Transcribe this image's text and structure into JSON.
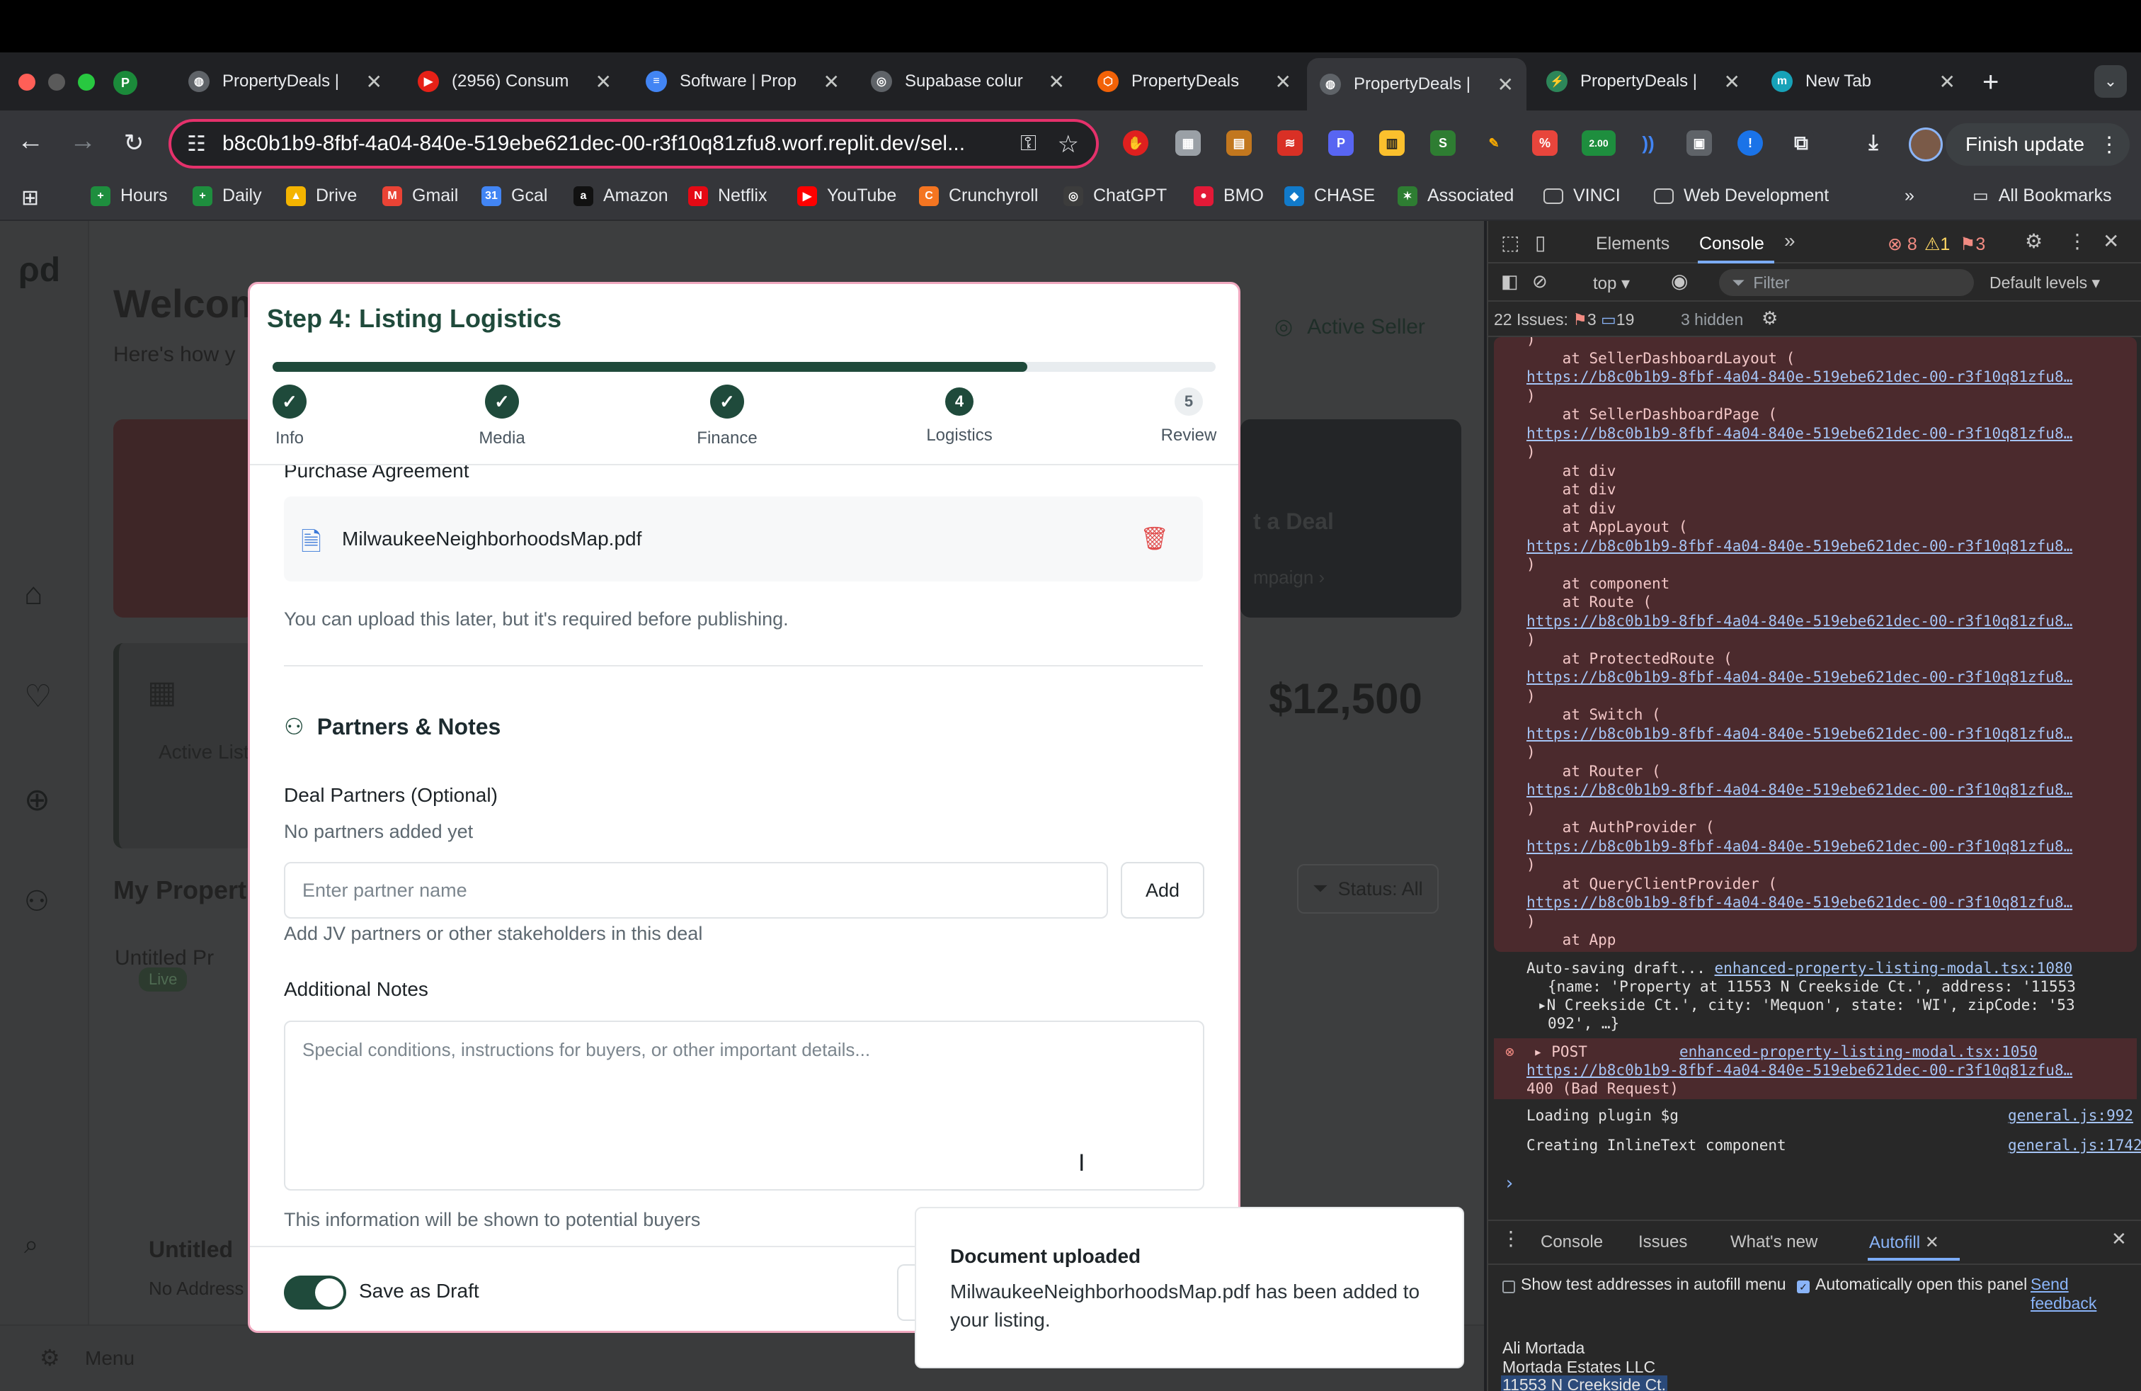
{
  "browser": {
    "tabs": [
      {
        "label": "PropertyDeals |",
        "fav_text": "P",
        "fav_color": "#1b8a3a",
        "is_profile": true
      },
      {
        "label": "PropertyDeals |",
        "fav_text": "◍",
        "fav_color": "#5f6368"
      },
      {
        "label": "(2956) Consum",
        "fav_text": "▶",
        "fav_color": "#e62117"
      },
      {
        "label": "Software | Prop",
        "fav_text": "≡",
        "fav_color": "#4285f4"
      },
      {
        "label": "Supabase colur",
        "fav_text": "◎",
        "fav_color": "#5f6368"
      },
      {
        "label": "PropertyDeals",
        "fav_text": "⬡",
        "fav_color": "#f26207"
      },
      {
        "label": "PropertyDeals |",
        "fav_text": "◍",
        "fav_color": "#5f6368",
        "active": true
      },
      {
        "label": "PropertyDeals |",
        "fav_text": "⚡",
        "fav_color": "#2d8659"
      },
      {
        "label": "New Tab",
        "fav_text": "m",
        "fav_color": "#17a2b8"
      }
    ],
    "url": "b8c0b1b9-8fbf-4a04-840e-519ebe621dec-00-r3f10q81zfu8.worf.replit.dev/sel...",
    "finish_update": "Finish update",
    "ext_badge": "2.00",
    "bookmarks": [
      {
        "label": "Hours",
        "icon": "+",
        "color": "#1e8e3e"
      },
      {
        "label": "Daily",
        "icon": "+",
        "color": "#1e8e3e"
      },
      {
        "label": "Drive",
        "icon": "▲",
        "color": "#f4b400"
      },
      {
        "label": "Gmail",
        "icon": "M",
        "color": "#ea4335"
      },
      {
        "label": "Gcal",
        "icon": "31",
        "color": "#4285f4"
      },
      {
        "label": "Amazon",
        "icon": "a",
        "color": "#111111"
      },
      {
        "label": "Netflix",
        "icon": "N",
        "color": "#e50914"
      },
      {
        "label": "YouTube",
        "icon": "▶",
        "color": "#ff0000"
      },
      {
        "label": "Crunchyroll",
        "icon": "C",
        "color": "#f47521"
      },
      {
        "label": "ChatGPT",
        "icon": "◎",
        "color": "#3c3c3c"
      },
      {
        "label": "BMO",
        "icon": "●",
        "color": "#e31937"
      },
      {
        "label": "CHASE",
        "icon": "◆",
        "color": "#117aca"
      },
      {
        "label": "Associated",
        "icon": "✶",
        "color": "#2e7d32"
      },
      {
        "label": "VINCI",
        "icon": "▭",
        "color": "#35363a"
      },
      {
        "label": "Web Development",
        "icon": "▭",
        "color": "#35363a"
      }
    ],
    "all_bookmarks": "All Bookmarks",
    "more_bookmarks": "»"
  },
  "background_page": {
    "welcome": "Welcom",
    "subtitle": "Here's how y",
    "active_seller": "Active Seller",
    "start_deal": "t a Deal",
    "campaign": "mpaign ›",
    "active_list": "Active List",
    "price": "$12,500",
    "my_props": "My Propert",
    "status_filter": "Status: All",
    "untitled_img": "Untitled Pr",
    "live_badge": "Live",
    "untitled": "Untitled",
    "no_address": "No Address",
    "menu": "Menu"
  },
  "modal": {
    "title": "Step 4: Listing Logistics",
    "progress": 0.8,
    "steps": [
      {
        "label": "Info",
        "state": "done",
        "num": "✓"
      },
      {
        "label": "Media",
        "state": "done",
        "num": "✓"
      },
      {
        "label": "Finance",
        "state": "done",
        "num": "✓"
      },
      {
        "label": "Logistics",
        "state": "current",
        "num": "4"
      },
      {
        "label": "Review",
        "state": "pending",
        "num": "5"
      }
    ],
    "purchase_agreement_label": "Purchase Agreement",
    "file_name": "MilwaukeeNeighborhoodsMap.pdf",
    "upload_hint": "You can upload this later, but it's required before publishing.",
    "partners_heading": "Partners & Notes",
    "deal_partners_label": "Deal Partners (Optional)",
    "no_partners": "No partners added yet",
    "partner_placeholder": "Enter partner name",
    "add_button": "Add",
    "partners_hint": "Add JV partners or other stakeholders in this deal",
    "notes_label": "Additional Notes",
    "notes_placeholder": "Special conditions, instructions for buyers, or other important details...",
    "notes_hint": "This information will be shown to potential buyers",
    "save_draft_label": "Save as Draft",
    "save_draft_on": true
  },
  "toast": {
    "title": "Document uploaded",
    "message": "MilwaukeeNeighborhoodsMap.pdf has been added to your listing."
  },
  "devtools": {
    "tabs": [
      "Elements",
      "Console"
    ],
    "active_tab": "Console",
    "errors": "8",
    "warnings": "1",
    "issues_badge": "3",
    "context": "top ▾",
    "filter_placeholder": "Filter",
    "levels": "Default levels ▾",
    "issues_text": "22 Issues:",
    "issues_err": "3",
    "issues_info": "19",
    "hidden": "3 hidden",
    "stack_link": "https://b8c0b1b9-8fbf-4a04-840e-519ebe621dec-00-r3f10q81zfu8…",
    "log_lines": [
      {
        "t": "plain",
        "text": ")"
      },
      {
        "t": "plain",
        "text": "    at SellerDashboardLayout ("
      },
      {
        "t": "link"
      },
      {
        "t": "plain",
        "text": ")"
      },
      {
        "t": "plain",
        "text": "    at SellerDashboardPage ("
      },
      {
        "t": "link"
      },
      {
        "t": "plain",
        "text": ")"
      },
      {
        "t": "plain",
        "text": "    at div"
      },
      {
        "t": "plain",
        "text": "    at div"
      },
      {
        "t": "plain",
        "text": "    at div"
      },
      {
        "t": "plain",
        "text": "    at AppLayout ("
      },
      {
        "t": "link"
      },
      {
        "t": "plain",
        "text": ")"
      },
      {
        "t": "plain",
        "text": "    at component"
      },
      {
        "t": "plain",
        "text": "    at Route ("
      },
      {
        "t": "link"
      },
      {
        "t": "plain",
        "text": ")"
      },
      {
        "t": "plain",
        "text": "    at ProtectedRoute ("
      },
      {
        "t": "link"
      },
      {
        "t": "plain",
        "text": ")"
      },
      {
        "t": "plain",
        "text": "    at Switch ("
      },
      {
        "t": "link"
      },
      {
        "t": "plain",
        "text": ")"
      },
      {
        "t": "plain",
        "text": "    at Router ("
      },
      {
        "t": "link"
      },
      {
        "t": "plain",
        "text": ")"
      },
      {
        "t": "plain",
        "text": "    at AuthProvider ("
      },
      {
        "t": "link"
      },
      {
        "t": "plain",
        "text": ")"
      },
      {
        "t": "plain",
        "text": "    at QueryClientProvider ("
      },
      {
        "t": "link"
      },
      {
        "t": "plain",
        "text": ")"
      },
      {
        "t": "plain",
        "text": "    at App"
      }
    ],
    "autosave": "Auto-saving draft...",
    "autosave_src": "enhanced-property-listing-modal.tsx:1080",
    "autosave_obj1": "{name: 'Property at 11553 N Creekside Ct.', address: '11553",
    "autosave_obj2": "▸N Creekside Ct.', city: 'Mequon', state: 'WI', zipCode: '53",
    "autosave_obj3": "092', …}",
    "post": "▸ POST",
    "post_src": "enhanced-property-listing-modal.tsx:1050",
    "post_status": "400 (Bad Request)",
    "plugin": "Loading plugin $g",
    "plugin_src": "general.js:992",
    "inline": "Creating InlineText component",
    "inline_src": "general.js:1742",
    "prompt": "›",
    "drawer_tabs": [
      "Console",
      "Issues",
      "What's new",
      "Autofill"
    ],
    "drawer_active": "Autofill",
    "autofill_opt1": "Show test addresses in autofill menu",
    "autofill_opt2": "Automatically open this panel",
    "send_feedback": "Send feedback",
    "addr_name": "Ali Mortada",
    "addr_company": "Mortada Estates LLC",
    "addr_street": "11553 N Creekside Ct."
  },
  "colors": {
    "brand_green": "#1f4a3b",
    "omnibox_border": "#e5316b",
    "error_red": "#e04b4b"
  }
}
